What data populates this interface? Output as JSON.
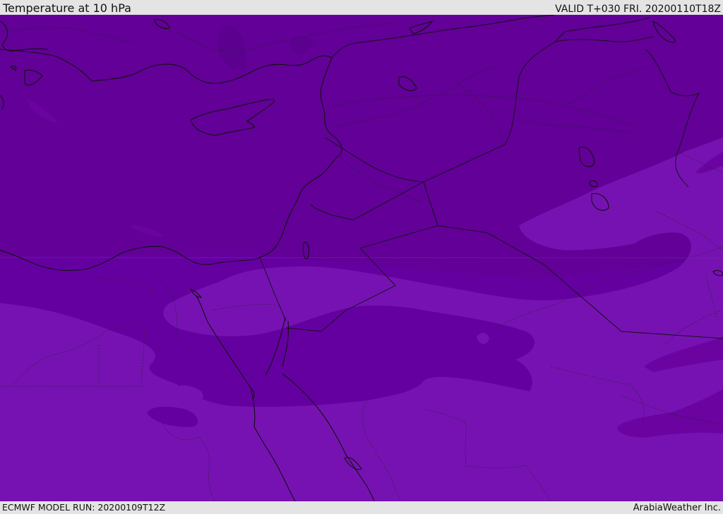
{
  "header": {
    "title": "Temperature at 10 hPa",
    "valid": "VALID T+030 FRI. 20200110T18Z"
  },
  "footer": {
    "model_run": "ECMWF MODEL RUN: 20200109T12Z",
    "credit": "ArabiaWeather Inc."
  },
  "map": {
    "colors": {
      "dark_band": "#620097",
      "mid_band": "#6a03a0",
      "light_band": "#7612b2",
      "coastline": "#111111",
      "border": "#111111"
    },
    "features": [
      "coastline",
      "country-borders",
      "province-borders",
      "temperature-shading"
    ]
  }
}
